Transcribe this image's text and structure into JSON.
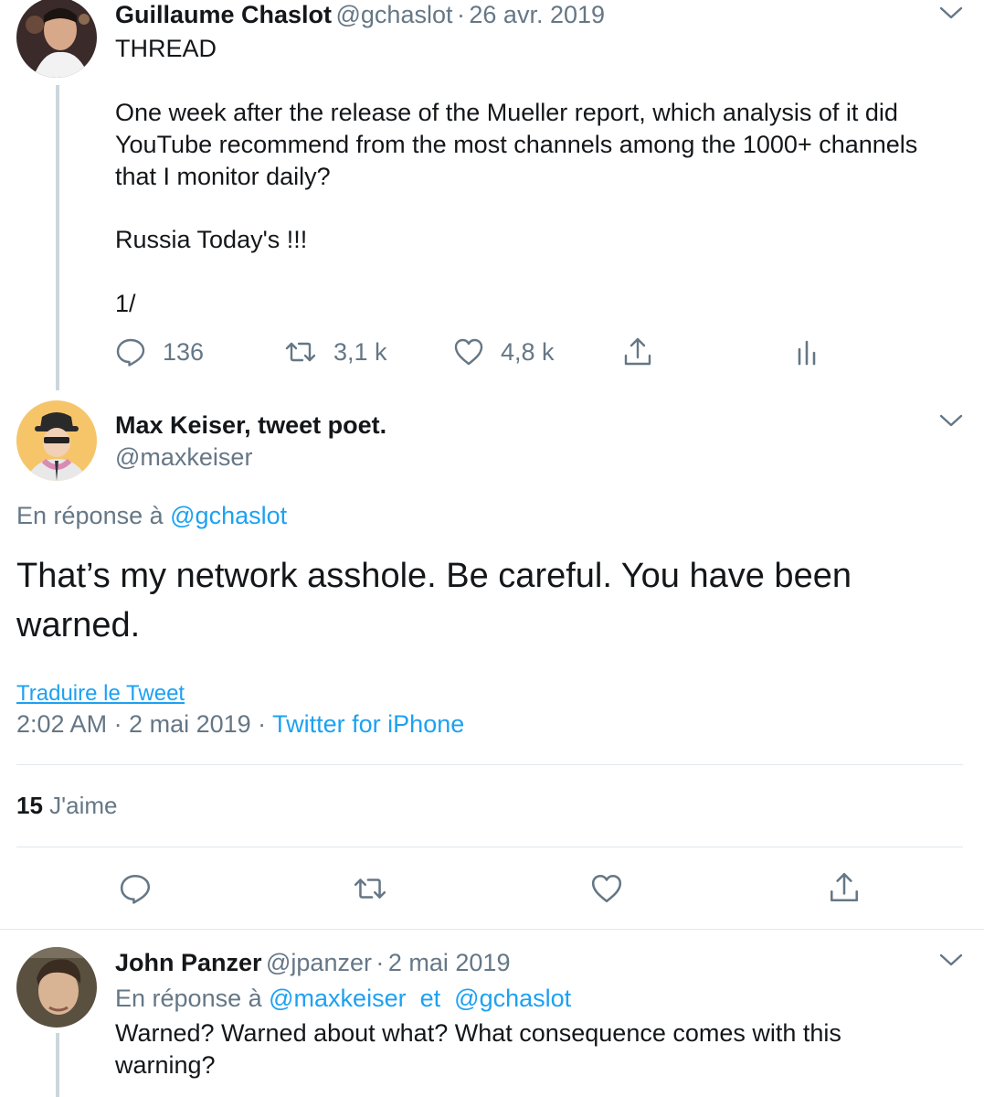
{
  "tweet1": {
    "author_name": "Guillaume Chaslot",
    "handle": "@gchaslot",
    "separator": "·",
    "date": "26 avr. 2019",
    "lines": [
      "THREAD",
      "One week after the release of the Mueller report, which analysis of it did",
      "YouTube recommend from the most channels among the 1000+ channels",
      "that I monitor daily?",
      "Russia Today's  !!!",
      "1/"
    ],
    "reply_count": "136",
    "retweet_count": "3,1 k",
    "like_count": "4,8 k"
  },
  "tweet2": {
    "author_name": "Max Keiser, tweet poet.",
    "handle": "@maxkeiser",
    "reply_prefix": "En réponse à",
    "reply_to": "@gchaslot",
    "text_lines": [
      "That’s my network asshole. Be careful. You have been",
      "warned."
    ],
    "translate_label": "Traduire le Tweet",
    "timestamp": "2:02 AM · 2 mai 2019 · ",
    "source": "Twitter for iPhone",
    "likes_count": "15",
    "likes_label": "J'aime"
  },
  "tweet3": {
    "author_name": "John Panzer",
    "handle": "@jpanzer",
    "separator": "·",
    "date": "2 mai 2019",
    "reply_prefix": "En réponse à",
    "reply_to_1": "@maxkeiser",
    "reply_joiner": "et",
    "reply_to_2": "@gchaslot",
    "lines": [
      "Warned?  Warned about what?  What consequence comes with this",
      "warning?"
    ]
  },
  "icons": {
    "reply": "reply-icon",
    "retweet": "retweet-icon",
    "like": "heart-icon",
    "share": "share-icon",
    "analytics": "analytics-icon",
    "more": "chevron-down-icon"
  },
  "colors": {
    "link": "#1da1f2",
    "muted": "#657786",
    "text": "#14171a",
    "divider": "#e1e8ed",
    "thread_line": "#ccd6dd"
  }
}
